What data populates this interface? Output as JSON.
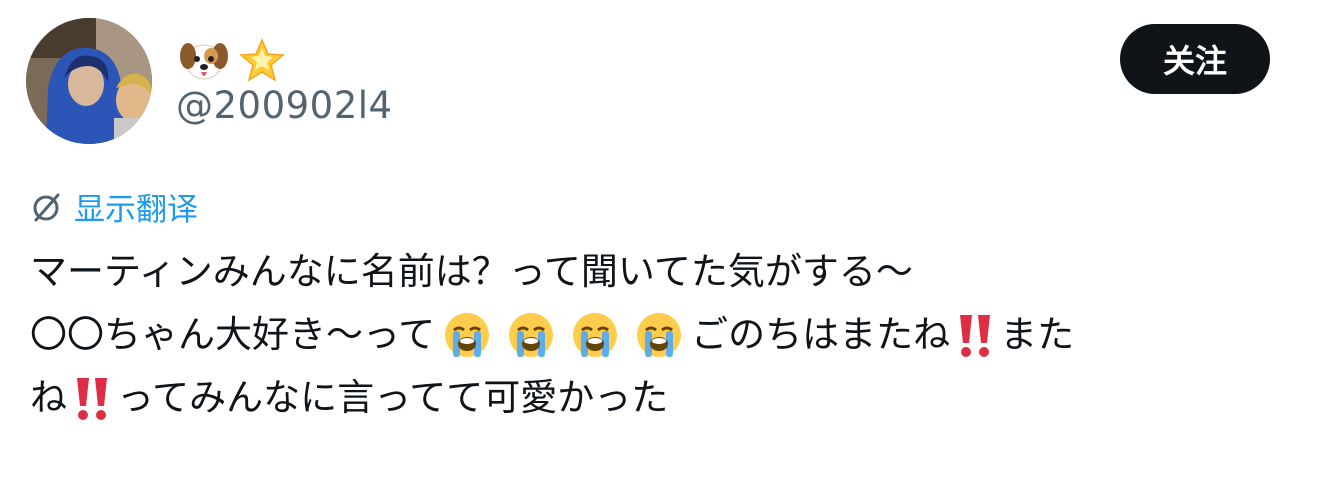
{
  "user": {
    "display_name_emojis": [
      "dog-face-emoji",
      "glowing-star-emoji"
    ],
    "handle": "@200902l4"
  },
  "follow_button": {
    "label": "关注"
  },
  "translate": {
    "icon": "translate-icon",
    "label": "显示翻译"
  },
  "tweet": {
    "line1": {
      "text": "マーティンみんなに名前は？って聞いてた気がする～"
    },
    "line2": {
      "seg1": "〇〇ちゃん大好き～って",
      "emojis": [
        "loudly-crying-face-emoji",
        "loudly-crying-face-emoji",
        "loudly-crying-face-emoji",
        "loudly-crying-face-emoji"
      ],
      "seg2": "ごのちはまたね",
      "emoji2": "double-exclamation-emoji",
      "seg3": "また"
    },
    "line3": {
      "seg1": "ね",
      "emoji1": "double-exclamation-emoji",
      "seg2": "ってみんなに言ってて可愛かった"
    }
  },
  "colors": {
    "text": "#0f1419",
    "handle": "#536471",
    "link": "#1d9bf0",
    "follow_bg": "#0f1419",
    "follow_text": "#ffffff"
  }
}
